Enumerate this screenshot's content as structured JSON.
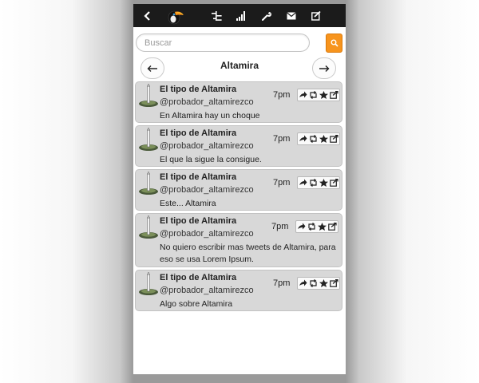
{
  "search": {
    "placeholder": "Buscar"
  },
  "page": {
    "title": "Altamira"
  },
  "tweets": [
    {
      "name": "El tipo de Altamira",
      "handle": "@probador_altamirezco",
      "time": "7pm",
      "text": "En Altamira hay un choque"
    },
    {
      "name": "El tipo de Altamira",
      "handle": "@probador_altamirezco",
      "time": "7pm",
      "text": "El que la sigue la consigue."
    },
    {
      "name": "El tipo de Altamira",
      "handle": "@probador_altamirezco",
      "time": "7pm",
      "text": "Este... Altamira"
    },
    {
      "name": "El tipo de Altamira",
      "handle": "@probador_altamirezco",
      "time": "7pm",
      "text": "No quiero escribir mas tweets de Altamira, para eso se usa Lorem Ipsum."
    },
    {
      "name": "El tipo de Altamira",
      "handle": "@probador_altamirezco",
      "time": "7pm",
      "text": "Algo sobre Altamira"
    }
  ],
  "icons": {
    "back": "chevron-left-icon",
    "logo": "toucan-logo",
    "timeline": "timeline-icon",
    "signal": "signal-bars-icon",
    "settings": "wrench-icon",
    "messages": "envelope-icon",
    "compose": "compose-icon",
    "search": "search-icon",
    "prev": "arrow-left-icon",
    "next": "arrow-right-icon",
    "reply": "reply-icon",
    "retweet": "retweet-icon",
    "favorite": "star-icon",
    "share": "share-icon"
  },
  "colors": {
    "topbar": "#1b1b1b",
    "accent": "#f7941d",
    "tweet_bg": "#d8d8d8"
  }
}
